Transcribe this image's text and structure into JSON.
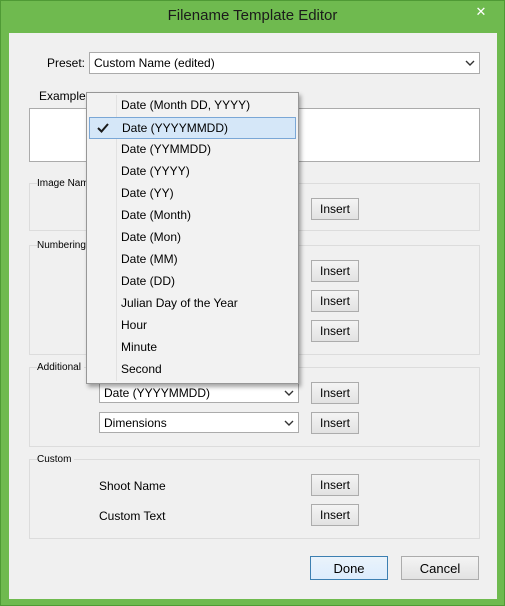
{
  "window": {
    "title": "Filename Template Editor",
    "close_glyph": "✕",
    "accent": "#6fba4f"
  },
  "preset": {
    "label": "Preset:",
    "value": "Custom Name (edited)"
  },
  "example": {
    "label": "Example:"
  },
  "groups": {
    "image_name": {
      "label": "Image Nam",
      "insert_label": "Insert"
    },
    "numbering": {
      "label": "Numbering",
      "insert_labels": [
        "Insert",
        "Insert",
        "Insert"
      ]
    },
    "additional": {
      "label": "Additional",
      "date_value": "Date (YYYYMMDD)",
      "dimensions_value": "Dimensions",
      "insert_labels": [
        "Insert",
        "Insert"
      ]
    },
    "custom": {
      "label": "Custom",
      "shoot_name_label": "Shoot Name",
      "custom_text_label": "Custom Text",
      "insert_labels": [
        "Insert",
        "Insert"
      ]
    }
  },
  "dropdown": {
    "selected_index": 1,
    "items": [
      "Date (Month DD, YYYY)",
      "Date (YYYYMMDD)",
      "Date (YYMMDD)",
      "Date (YYYY)",
      "Date (YY)",
      "Date (Month)",
      "Date (Mon)",
      "Date (MM)",
      "Date (DD)",
      "Julian Day of the Year",
      "Hour",
      "Minute",
      "Second"
    ],
    "check_icon": "checkmark-icon"
  },
  "buttons": {
    "done": "Done",
    "cancel": "Cancel"
  }
}
